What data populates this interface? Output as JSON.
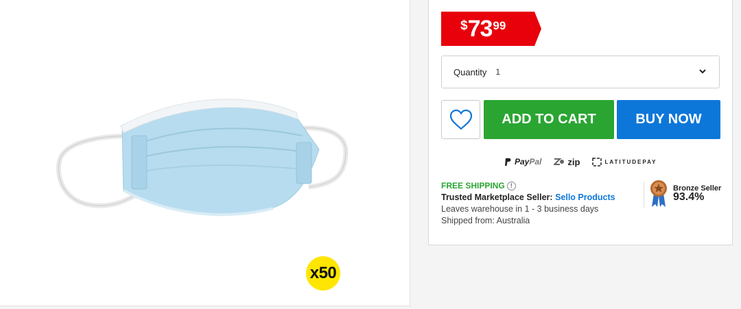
{
  "product": {
    "image_icon": "surgical-mask-image",
    "pack_badge": "x50"
  },
  "buy_box": {
    "price": {
      "dollar_sign": "$",
      "main": "73",
      "cents": "99",
      "tag_color": "#e8000b"
    },
    "quantity": {
      "label": "Quantity",
      "value": "1",
      "icon": "chevron-down-icon"
    },
    "wishlist_icon": "heart-icon",
    "add_to_cart_label": "ADD TO CART",
    "buy_now_label": "BUY NOW",
    "colors": {
      "add_to_cart": "#2aa532",
      "buy_now": "#0d77d9"
    },
    "payment_methods": {
      "paypal_pay": "Pay",
      "paypal_pal": "Pal",
      "zip": "zip",
      "latitude": "LATITUDEPAY"
    },
    "shipping": {
      "free_shipping": "FREE SHIPPING",
      "info_icon_glyph": "!",
      "trusted_label": "Trusted Marketplace Seller:",
      "seller_name": "Sello Products",
      "leaves_warehouse": "Leaves warehouse in 1 - 3 business days",
      "shipped_from": "Shipped from: Australia"
    },
    "seller_rating": {
      "icon": "bronze-medal-icon",
      "title": "Bronze Seller",
      "percent": "93.4%"
    }
  }
}
